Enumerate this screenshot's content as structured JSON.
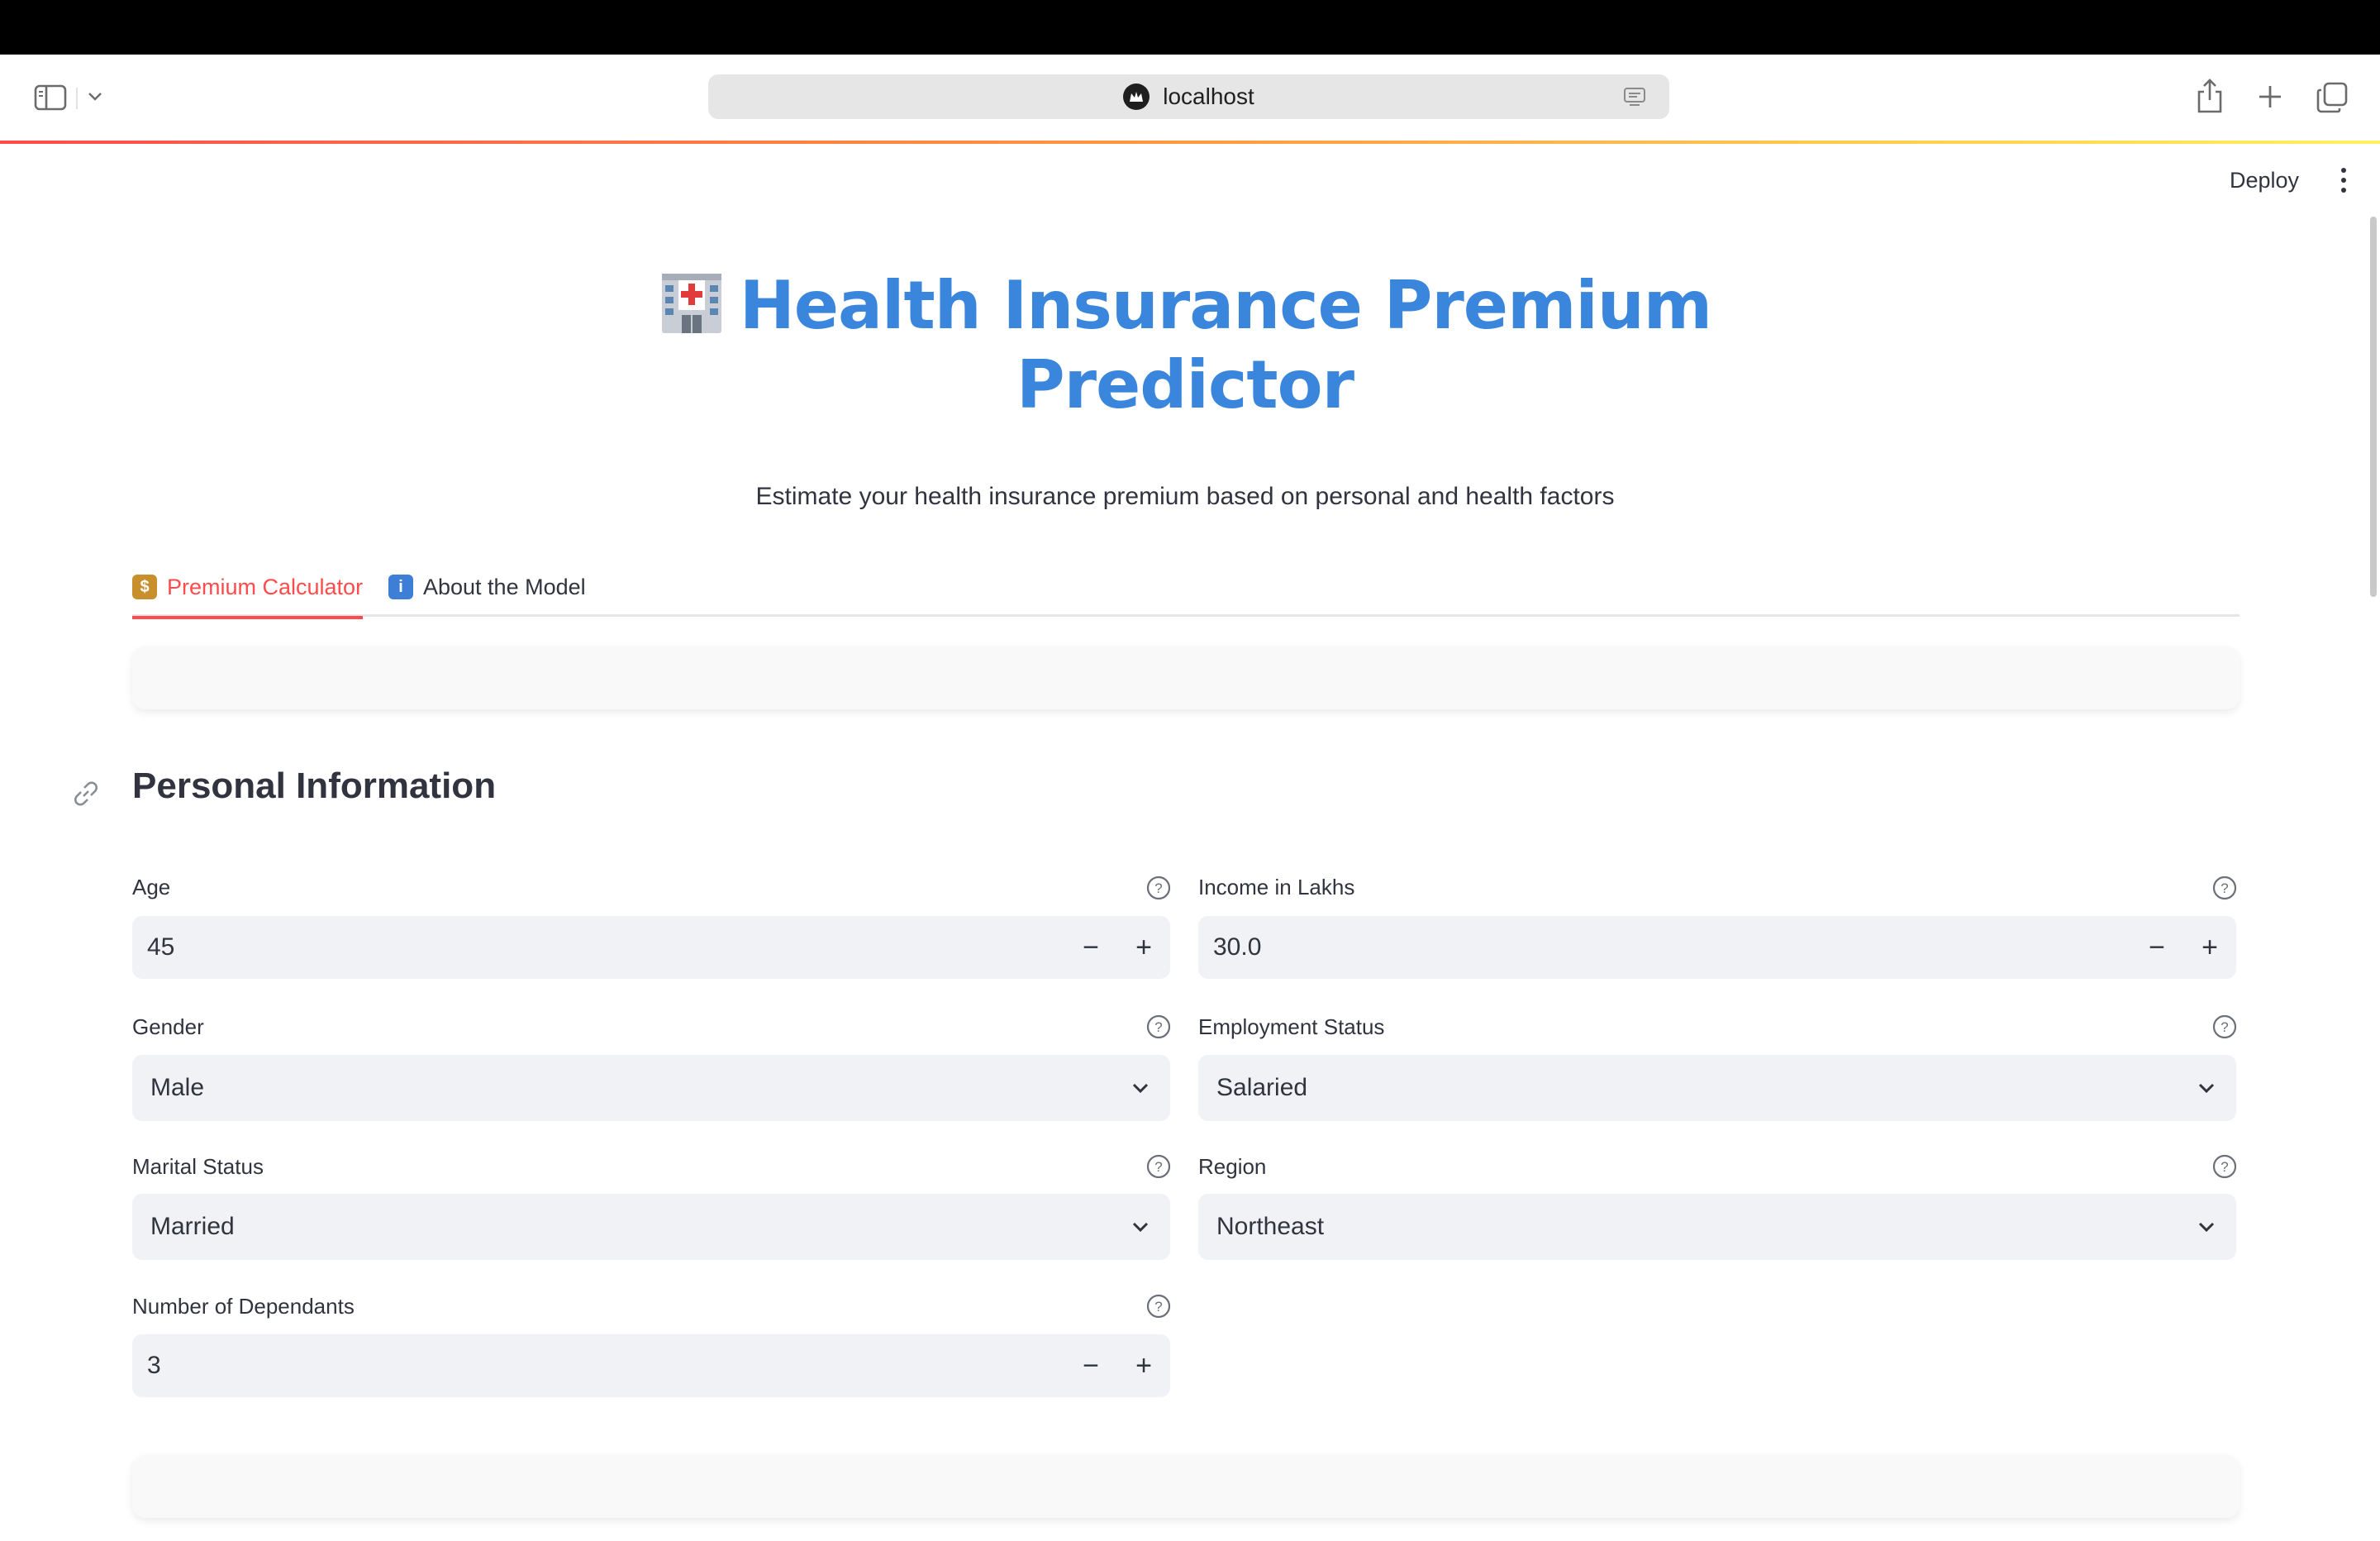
{
  "browser": {
    "url": "localhost"
  },
  "app_header": {
    "deploy_label": "Deploy"
  },
  "page": {
    "title": "Health Insurance Premium Predictor",
    "subtitle": "Estimate your health insurance premium based on personal and health factors"
  },
  "tabs": [
    {
      "label": "Premium Calculator",
      "icon": "money-bag-icon",
      "active": true
    },
    {
      "label": "About the Model",
      "icon": "info-icon",
      "active": false
    }
  ],
  "section": {
    "heading": "Personal Information"
  },
  "fields": {
    "age": {
      "label": "Age",
      "value": "45"
    },
    "income": {
      "label": "Income in Lakhs",
      "value": "30.0"
    },
    "gender": {
      "label": "Gender",
      "value": "Male"
    },
    "employment": {
      "label": "Employment Status",
      "value": "Salaried"
    },
    "marital": {
      "label": "Marital Status",
      "value": "Married"
    },
    "region": {
      "label": "Region",
      "value": "Northeast"
    },
    "dependants": {
      "label": "Number of Dependants",
      "value": "3"
    }
  },
  "colors": {
    "title": "#3a86dd",
    "accent": "#ff4b4b",
    "input_bg": "#f0f2f6"
  }
}
